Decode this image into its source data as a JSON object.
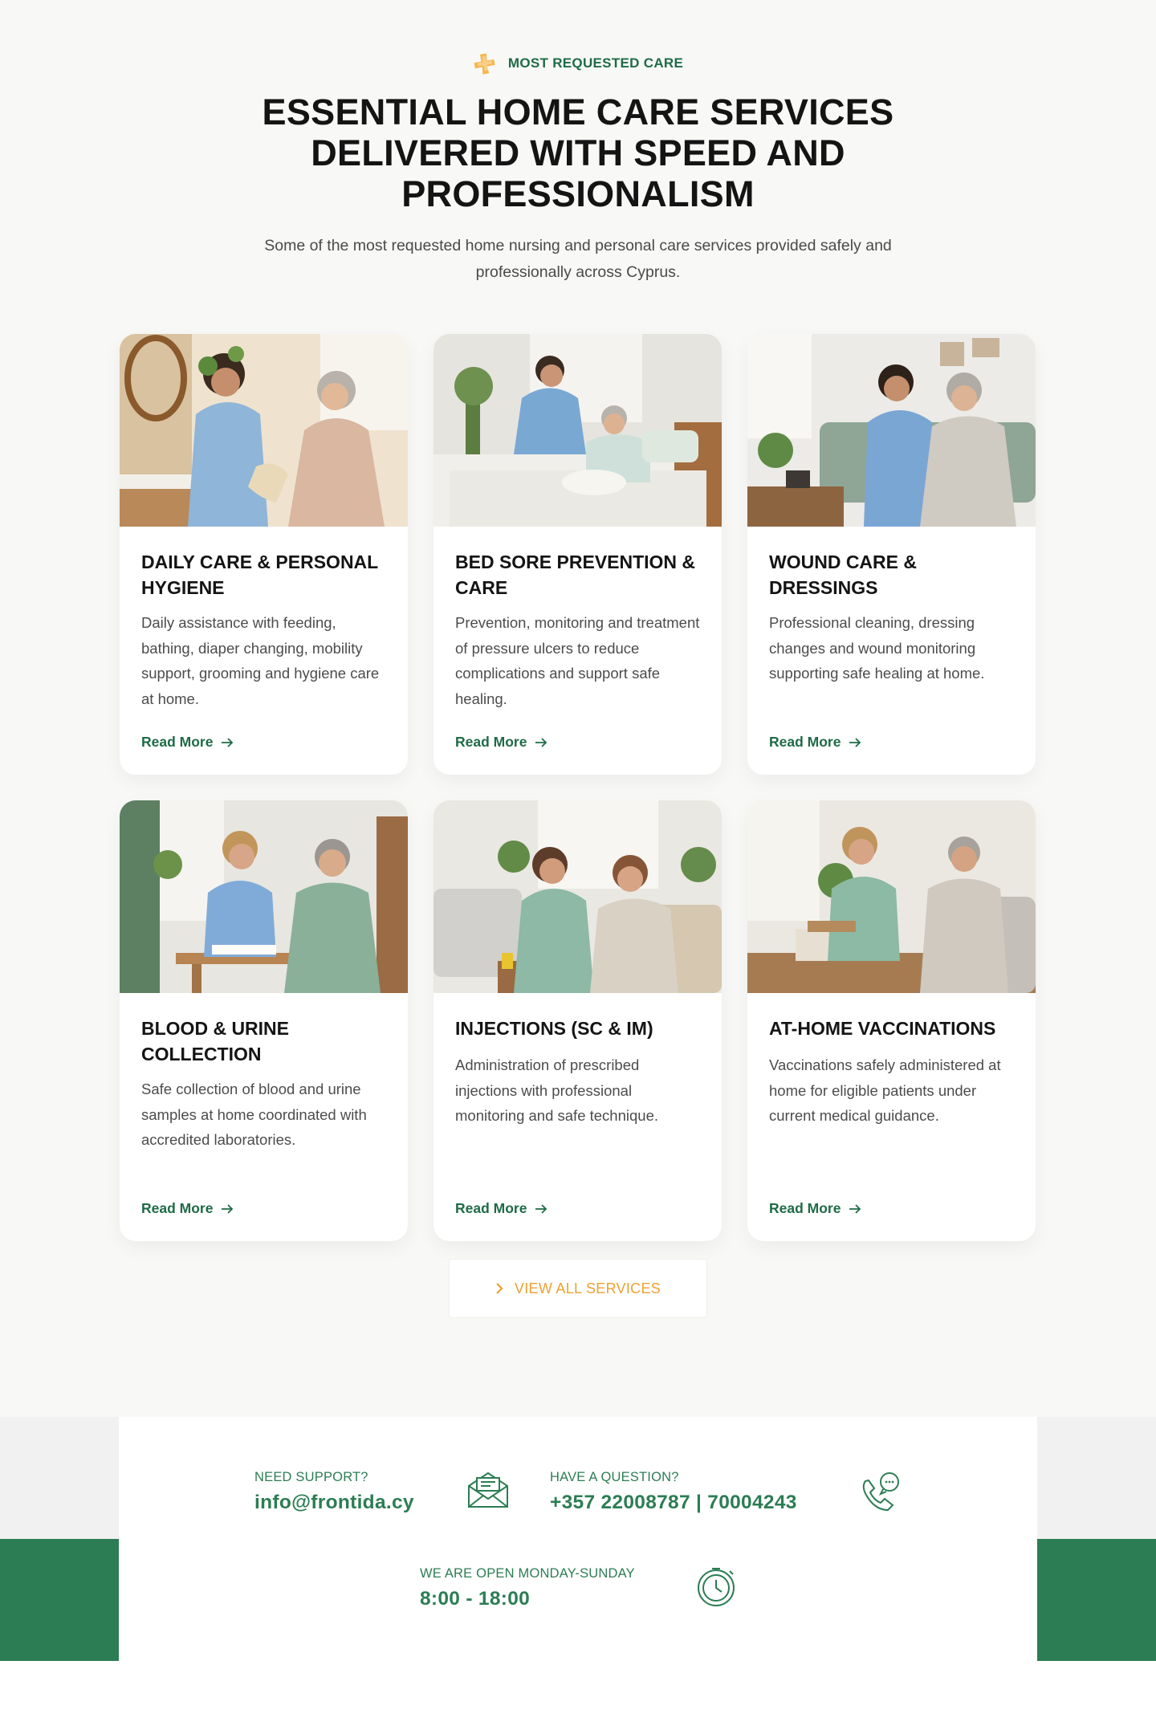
{
  "header": {
    "eyebrow": "MOST REQUESTED CARE",
    "headline": "ESSENTIAL HOME CARE SERVICES DELIVERED WITH SPEED AND PROFESSIONALISM",
    "subtitle": "Some of the most requested home nursing and personal care services provided safely and professionally across Cyprus."
  },
  "services": [
    {
      "title": "DAILY CARE & PERSONAL HYGIENE",
      "description": "Daily assistance with feeding, bathing, diaper changing, mobility support, grooming and hygiene care at home.",
      "link": "Read More"
    },
    {
      "title": "BED SORE PREVENTION & CARE",
      "description": "Prevention, monitoring and treatment of pressure ulcers to reduce complications and support safe healing.",
      "link": "Read More"
    },
    {
      "title": "WOUND CARE & DRESSINGS",
      "description": "Professional cleaning, dressing changes and wound monitoring supporting safe healing at home.",
      "link": "Read More"
    },
    {
      "title": "BLOOD & URINE COLLECTION",
      "description": "Safe collection of blood and urine samples at home coordinated with accredited laboratories.",
      "link": "Read More"
    },
    {
      "title": "INJECTIONS (SC & IM)",
      "description": "Administration of prescribed injections with professional monitoring and safe technique.",
      "link": "Read More"
    },
    {
      "title": "AT-HOME VACCINATIONS",
      "description": "Vaccinations safely administered at home for eligible patients under current medical guidance.",
      "link": "Read More"
    }
  ],
  "view_all": "VIEW ALL SERVICES",
  "contact": {
    "support_label": "NEED SUPPORT?",
    "support_value": "info@frontida.cy",
    "question_label": "HAVE A QUESTION?",
    "question_value": "+357 22008787 | 70004243",
    "hours_label": "WE ARE OPEN MONDAY-SUNDAY",
    "hours_value": "8:00 - 18:00"
  },
  "colors": {
    "brand_green": "#2c7d53",
    "accent_orange": "#f0a032",
    "heading": "#141414"
  },
  "icons": [
    "plus-badge-icon",
    "arrow-right-icon",
    "chevron-right-icon",
    "envelope-icon",
    "phone-chat-icon",
    "clock-icon"
  ]
}
